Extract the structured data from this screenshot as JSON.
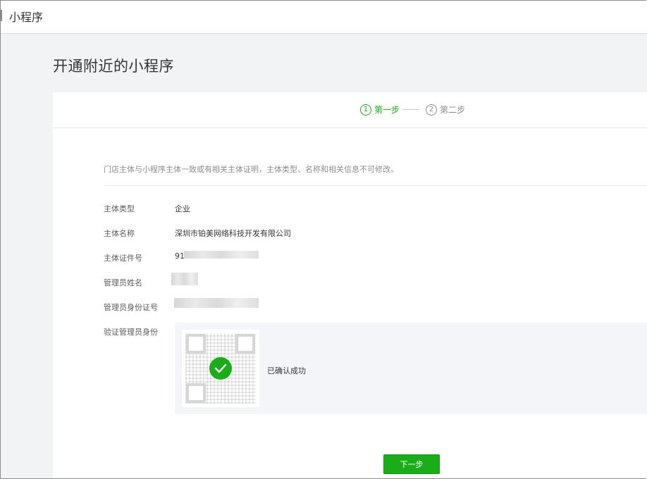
{
  "topbar": {
    "title": "小程序"
  },
  "page": {
    "title": "开通附近的小程序"
  },
  "steps": [
    {
      "number": "1",
      "label": "第一步",
      "state": "active"
    },
    {
      "number": "2",
      "label": "第二步",
      "state": "inactive"
    }
  ],
  "notice": "门店主体与小程序主体一致或有相关主体证明，主体类型、名称和相关信息不可修改。",
  "fields": {
    "entity_type": {
      "label": "主体类型",
      "value": "企业"
    },
    "entity_name": {
      "label": "主体名称",
      "value": "深圳市铂美网络科技开发有限公司"
    },
    "entity_id": {
      "label": "主体证件号",
      "value": "91"
    },
    "admin_name": {
      "label": "管理员姓名"
    },
    "admin_id": {
      "label": "管理员身份证号"
    },
    "verify": {
      "label": "验证管理员身份",
      "status": "已确认成功"
    }
  },
  "buttons": {
    "next": "下一步"
  },
  "colors": {
    "accent": "#1aad19",
    "background": "#f2f3f5"
  },
  "icons": {
    "qr": "qr-code-icon",
    "check": "check-circle-icon"
  }
}
